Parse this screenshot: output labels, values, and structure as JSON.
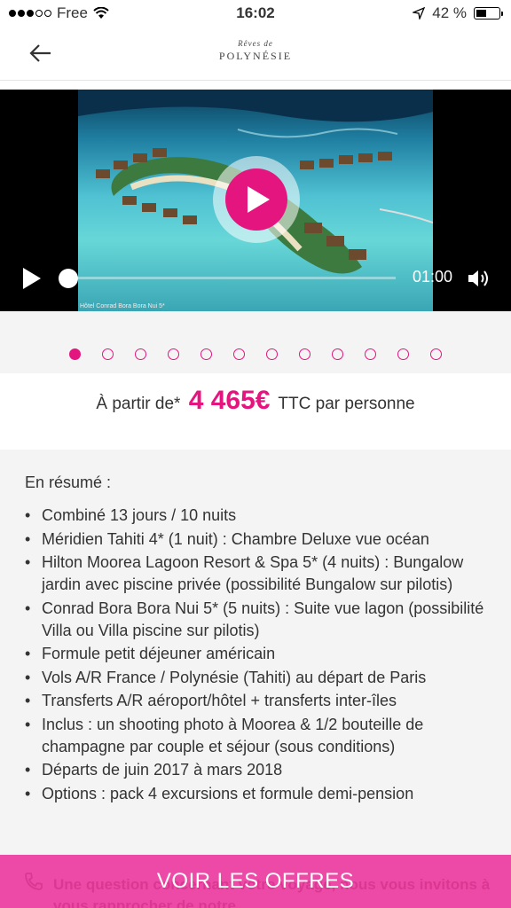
{
  "status_bar": {
    "carrier": "Free",
    "time": "16:02",
    "battery": "42 %"
  },
  "header": {
    "logo_line1": "Rêves de",
    "logo_line2": "POLYNÉSIE"
  },
  "video": {
    "caption": "Hôtel Conrad Bora Bora Nui 5*",
    "time": "01:00"
  },
  "pager": {
    "count": 12,
    "active": 0
  },
  "price": {
    "prefix": "À partir de*",
    "amount": "4 465€",
    "suffix": "TTC par personne"
  },
  "summary": {
    "title": "En résumé :",
    "items": [
      "Combiné 13 jours / 10 nuits",
      "Méridien Tahiti 4* (1 nuit) : Chambre Deluxe vue océan",
      "Hilton Moorea Lagoon Resort & Spa 5* (4 nuits) : Bungalow jardin avec piscine privée (possibilité Bungalow sur pilotis)",
      "Conrad Bora Bora Nui 5* (5 nuits) : Suite vue lagon (possibilité Villa ou Villa piscine sur pilotis)",
      "Formule petit déjeuner américain",
      "Vols A/R France / Polynésie (Tahiti) au départ de Paris",
      "Transferts A/R aéroport/hôtel + transferts inter-îles",
      "Inclus : un shooting photo à Moorea & 1/2 bouteille de champagne par couple et séjour (sous conditions)",
      "Départs de juin 2017 à mars 2018",
      "Options : pack 4 excursions et formule demi-pension"
    ]
  },
  "cta": {
    "label": "VOIR LES OFFRES",
    "background_text": "Une question concernant votre voyage, nous vous invitons à vous rapprocher de notre"
  },
  "colors": {
    "accent": "#e5157f",
    "cta_bg": "#ec4aa6"
  }
}
